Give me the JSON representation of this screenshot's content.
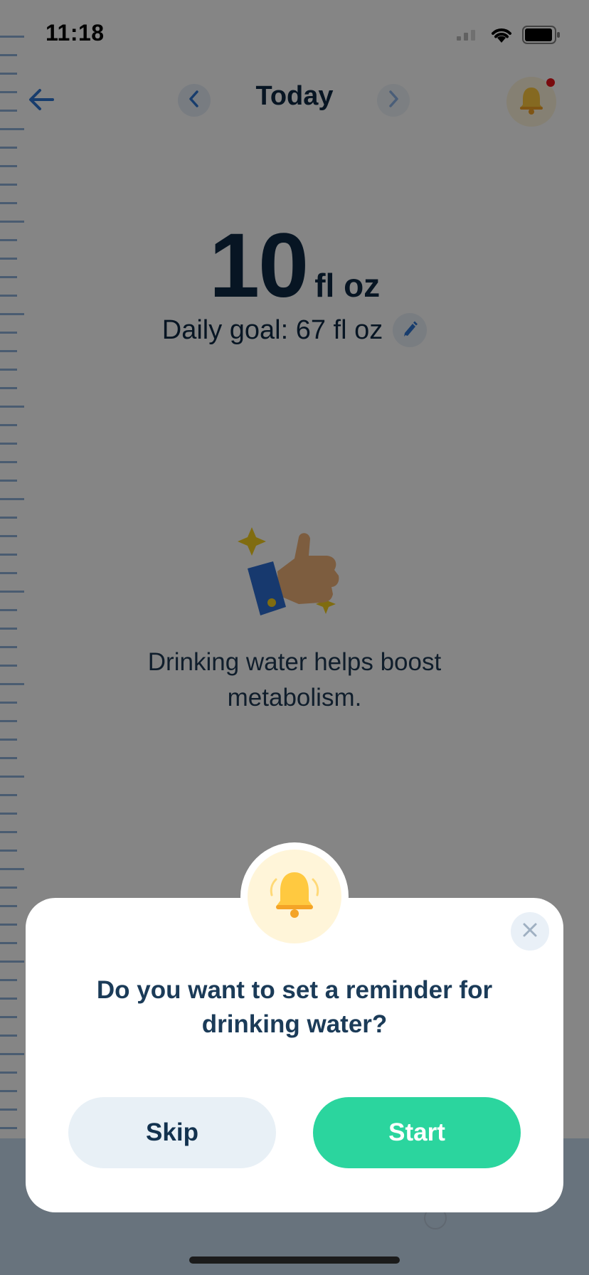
{
  "status_bar": {
    "time": "11:18"
  },
  "nav": {
    "title": "Today"
  },
  "intake": {
    "value": "10",
    "unit": "fl oz",
    "goal_label": "Daily goal: 67 fl oz"
  },
  "tip": {
    "text": "Drinking water helps boost metabolism."
  },
  "modal": {
    "question": "Do you want to set a reminder for drinking water?",
    "skip_label": "Skip",
    "start_label": "Start"
  },
  "icons": {
    "back": "back-arrow-icon",
    "prev": "chevron-left-icon",
    "next": "chevron-right-icon",
    "bell": "bell-icon",
    "edit": "pencil-icon",
    "close": "close-icon",
    "illustration": "thumbs-up-icon"
  },
  "colors": {
    "accent": "#2bd59e",
    "primary_text": "#0f2a44",
    "notification_dot": "#e8141a",
    "bell": "#ffc940"
  }
}
